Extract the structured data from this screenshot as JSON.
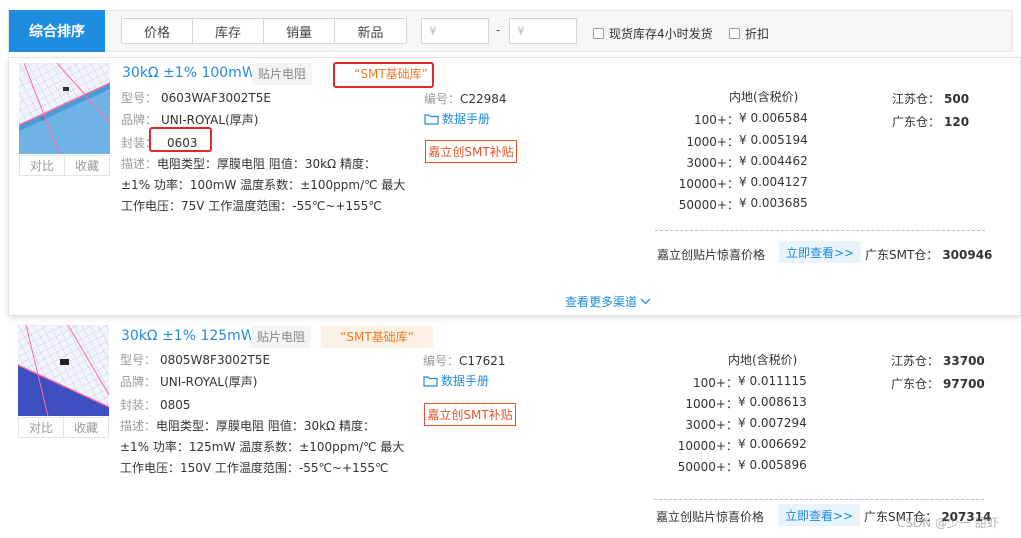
{
  "sortbar": {
    "main_label": "综合排序",
    "tabs": [
      "价格",
      "库存",
      "销量",
      "新品"
    ],
    "price_min_placeholder": "¥",
    "price_max_placeholder": "¥",
    "price_dash": "-",
    "checkbox_fast_ship": "现货库存4小时发货",
    "checkbox_discount": "折扣"
  },
  "products": [
    {
      "title": "30kΩ ±1% 100mW",
      "category_tag": "贴片电阻",
      "smt_tag": "“SMT基础库”",
      "model_label": "型号：",
      "model": "0603WAF3002T5E",
      "brand_label": "品牌：",
      "brand": "UNI-ROYAL(厚声)",
      "package_label": "封装：",
      "package": "0603",
      "compare_label": "对比",
      "favorite_label": "收藏",
      "desc_label": "描述：",
      "desc_line1": "电阻类型：厚膜电阻 阻值：30kΩ 精度：",
      "desc_line2": "±1% 功率：100mW 温度系数：±100ppm/℃ 最大",
      "desc_line3": "工作电压：75V 工作温度范围：-55℃~+155℃",
      "code_label": "编号：",
      "code": "C22984",
      "datasheet_label": "数据手册",
      "smt_button": "嘉立创SMT补贴",
      "price_header": "内地(含税价)",
      "prices": [
        {
          "qty": "100+：",
          "price": "¥ 0.006584"
        },
        {
          "qty": "1000+：",
          "price": "¥ 0.005194"
        },
        {
          "qty": "3000+：",
          "price": "¥ 0.004462"
        },
        {
          "qty": "10000+：",
          "price": "¥ 0.004127"
        },
        {
          "qty": "50000+：",
          "price": "¥ 0.003685"
        }
      ],
      "stock_js_label": "江苏仓：",
      "stock_js": "500",
      "stock_gd_label": "广东仓：",
      "stock_gd": "120",
      "promo_label": "嘉立创贴片惊喜价格",
      "promo_button": "立即查看>>",
      "promo_stock_label": "广东SMT仓：",
      "promo_stock": "300946",
      "more_channels": "查看更多渠道"
    },
    {
      "title": "30kΩ ±1% 125mW",
      "category_tag": "贴片电阻",
      "smt_tag": "“SMT基础库”",
      "model_label": "型号：",
      "model": "0805W8F3002T5E",
      "brand_label": "品牌：",
      "brand": "UNI-ROYAL(厚声)",
      "package_label": "封装：",
      "package": "0805",
      "compare_label": "对比",
      "favorite_label": "收藏",
      "desc_label": "描述：",
      "desc_line1": "电阻类型：厚膜电阻 阻值：30kΩ 精度：",
      "desc_line2": "±1% 功率：125mW 温度系数：±100ppm/℃ 最大",
      "desc_line3": "工作电压：150V 工作温度范围：-55℃~+155℃",
      "code_label": "编号：",
      "code": "C17621",
      "datasheet_label": "数据手册",
      "smt_button": "嘉立创SMT补贴",
      "price_header": "内地(含税价)",
      "prices": [
        {
          "qty": "100+：",
          "price": "¥ 0.011115"
        },
        {
          "qty": "1000+：",
          "price": "¥ 0.008613"
        },
        {
          "qty": "3000+：",
          "price": "¥ 0.007294"
        },
        {
          "qty": "10000+：",
          "price": "¥ 0.006692"
        },
        {
          "qty": "50000+：",
          "price": "¥ 0.005896"
        }
      ],
      "stock_js_label": "江苏仓：",
      "stock_js": "33700",
      "stock_gd_label": "广东仓：",
      "stock_gd": "97700",
      "promo_label": "嘉立创贴片惊喜价格",
      "promo_button": "立即查看>>",
      "promo_stock_label": "广东SMT仓：",
      "promo_stock": "207314"
    }
  ],
  "watermark": "CSDN @少一 甜虾",
  "colors": {
    "accent": "#1e8ce0",
    "highlight_box": "#e02a2a",
    "smt_orange": "#f07a22",
    "smt_button": "#e0542a"
  }
}
